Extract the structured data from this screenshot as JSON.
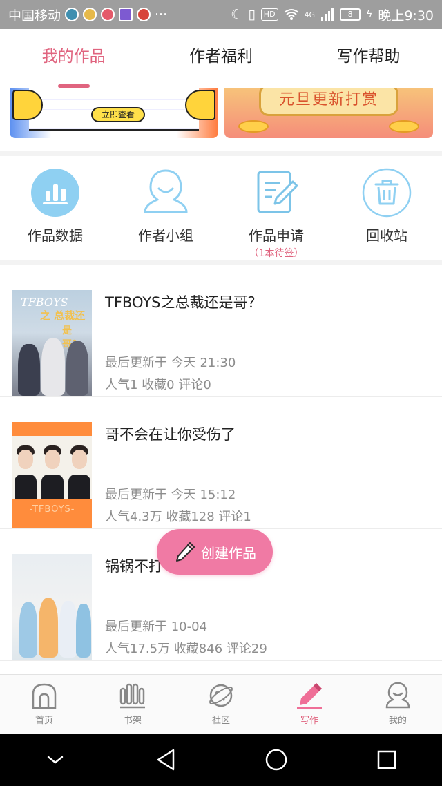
{
  "status_bar": {
    "carrier": "中国移动",
    "more": "···",
    "hd_badge": "HD",
    "network": "4G",
    "battery": "8",
    "time": "晚上9:30"
  },
  "top_tabs": [
    {
      "label": "我的作品",
      "active": true
    },
    {
      "label": "作者福利",
      "active": false
    },
    {
      "label": "写作帮助",
      "active": false
    }
  ],
  "banners": {
    "left_button": "立即查看",
    "right_title": "元旦更新打赏"
  },
  "quick_menu": [
    {
      "label": "作品数据",
      "icon": "bar-chart-icon"
    },
    {
      "label": "作者小组",
      "icon": "group-person-icon"
    },
    {
      "label": "作品申请",
      "icon": "edit-document-icon",
      "sub": "（1本待签）"
    },
    {
      "label": "回收站",
      "icon": "trash-icon"
    }
  ],
  "works": [
    {
      "title": "TFBOYS之总裁还是哥？",
      "updated": "最后更新于 今天 21:30",
      "stats": "人气1  收藏0  评论0",
      "cover_text": [
        "TFBOYS",
        "之 总裁还",
        "是 哥？"
      ]
    },
    {
      "title": "哥不会在让你受伤了",
      "updated": "最后更新于 今天 15:12",
      "stats": "人气4.3万  收藏128  评论1",
      "cover_text": [
        "-TFBOYS-"
      ]
    },
    {
      "title": "锅锅不打",
      "updated": "最后更新于 10-04",
      "stats": "人气17.5万  收藏846  评论29"
    }
  ],
  "fab": {
    "label": "创建作品"
  },
  "bottom_nav": [
    {
      "label": "首页",
      "active": false
    },
    {
      "label": "书架",
      "active": false
    },
    {
      "label": "社区",
      "active": false
    },
    {
      "label": "写作",
      "active": true
    },
    {
      "label": "我的",
      "active": false
    }
  ],
  "colors": {
    "accent": "#e0647f",
    "fab": "#f07aa4",
    "icon_blue": "#5bb8e8"
  }
}
